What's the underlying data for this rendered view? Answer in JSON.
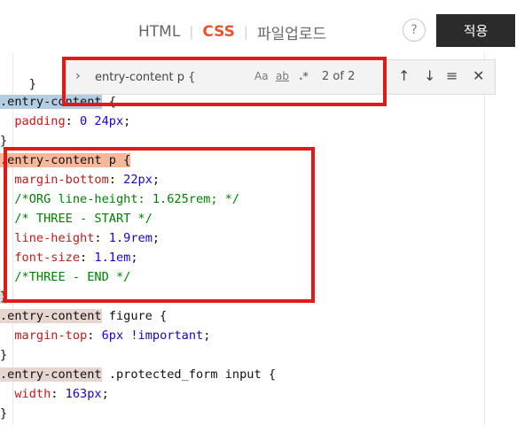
{
  "toolbar": {
    "tabs": [
      {
        "label": "HTML",
        "active": false
      },
      {
        "label": "CSS",
        "active": true
      },
      {
        "label": "파일업로드",
        "active": false
      }
    ],
    "help_label": "?",
    "apply_label": "적용",
    "active_color": "#e8552d"
  },
  "find": {
    "query": "entry-content p {",
    "toggle_icon": "chevron-right-icon",
    "match_case_label": "Aa",
    "whole_word_label": "ab",
    "regex_label": ".*",
    "match_count": "2 of 2",
    "prev_icon": "arrow-up-icon",
    "next_icon": "arrow-down-icon",
    "selection_icon": "lines-icon",
    "close_icon": "close-icon"
  },
  "code": {
    "line0": {
      "brace": "}"
    },
    "line1": {
      "selector_a": ".entry-",
      "selector_b": "content",
      "brace": " {"
    },
    "line2": {
      "prop": "padding",
      "value": "0 24px",
      "end": ";"
    },
    "line3": {
      "brace": "}"
    },
    "line4": {
      "sel_a": ".entry-c",
      "sel_b": "ontent",
      "sel_c": " p",
      "brace": " {"
    },
    "line5": {
      "prop": "margin-bottom",
      "value": "22px",
      "end": ";"
    },
    "line6": {
      "comment": "/*ORG line-height: 1.625rem; */"
    },
    "line7": {
      "comment": "/* THREE - START */"
    },
    "line8": {
      "prop": "line-height",
      "value": "1.9rem",
      "end": ";"
    },
    "line9": {
      "prop": "font-size",
      "value": "1.1em",
      "end": ";"
    },
    "line10": {
      "comment": "/*THREE - END */"
    },
    "line11": {
      "brace": "}"
    },
    "line12": {
      "selector": ".entry-content",
      "rest": " figure {"
    },
    "line13": {
      "prop": "margin-top",
      "value": "6px",
      "important": "!important",
      "end": ";"
    },
    "line14": {
      "brace": "}"
    },
    "line15": {
      "selector": ".entry-content",
      "rest": " .protected_form input {"
    },
    "line16": {
      "prop": "width",
      "value": "163px",
      "end": ";"
    },
    "line17": {
      "brace": "}"
    }
  }
}
